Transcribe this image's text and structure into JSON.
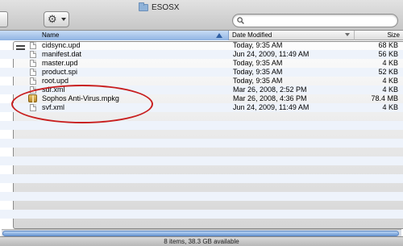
{
  "window": {
    "title": "ESOSX",
    "status": "8 items, 38.3 GB available"
  },
  "search": {
    "value": "",
    "placeholder": ""
  },
  "columns": {
    "name": "Name",
    "date": "Date Modified",
    "size": "Size"
  },
  "files": [
    {
      "name": "cidsync.upd",
      "date": "Today, 9:35 AM",
      "size": "68 KB",
      "icon": "document-icon"
    },
    {
      "name": "manifest.dat",
      "date": "Jun 24, 2009, 11:49 AM",
      "size": "56 KB",
      "icon": "document-icon"
    },
    {
      "name": "master.upd",
      "date": "Today, 9:35 AM",
      "size": "4 KB",
      "icon": "document-icon"
    },
    {
      "name": "product.spi",
      "date": "Today, 9:35 AM",
      "size": "52 KB",
      "icon": "document-icon"
    },
    {
      "name": "root.upd",
      "date": "Today, 9:35 AM",
      "size": "4 KB",
      "icon": "document-icon"
    },
    {
      "name": "sdf.xml",
      "date": "Mar 26, 2008, 2:52 PM",
      "size": "4 KB",
      "icon": "document-icon"
    },
    {
      "name": "Sophos Anti-Virus.mpkg",
      "date": "Mar 26, 2008, 4:36 PM",
      "size": "78.4 MB",
      "icon": "package-icon"
    },
    {
      "name": "svf.xml",
      "date": "Jun 24, 2009, 11:49 AM",
      "size": "4 KB",
      "icon": "document-icon"
    }
  ],
  "colors": {
    "annotation": "#c81e1e",
    "header_selected": "#8fb3e3",
    "row_alt": "#eef3fb"
  }
}
